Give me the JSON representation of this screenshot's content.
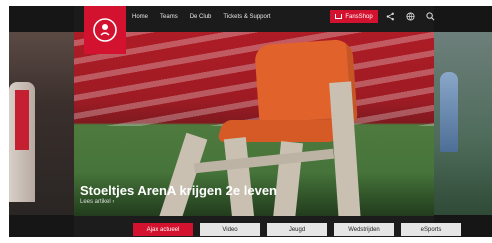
{
  "brand": {
    "name": "Ajax",
    "accent": "#d2122e"
  },
  "nav": {
    "items": [
      "Home",
      "Teams",
      "De Club",
      "Tickets & Support"
    ]
  },
  "fanshop": {
    "label": "FansShop"
  },
  "top_icons": [
    "share-icon",
    "globe-icon",
    "search-icon"
  ],
  "hero": {
    "headline": "Stoeltjes ArenA krijgen 2e leven",
    "read_more": "Lees artikel ›"
  },
  "tabs": {
    "items": [
      {
        "label": "Ajax actueel",
        "active": true
      },
      {
        "label": "Video",
        "active": false
      },
      {
        "label": "Jeugd",
        "active": false
      },
      {
        "label": "Wedstrijden",
        "active": false
      },
      {
        "label": "eSports",
        "active": false
      }
    ]
  }
}
